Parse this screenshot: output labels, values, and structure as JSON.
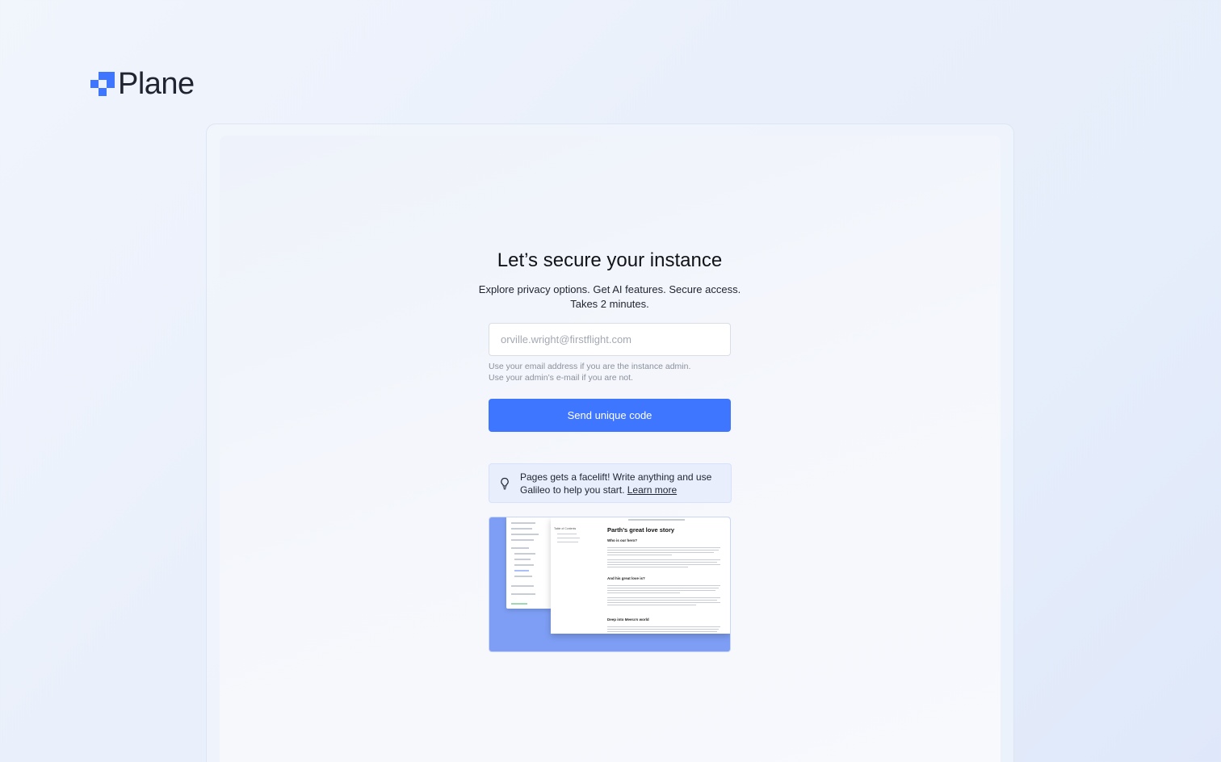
{
  "brand": {
    "name": "Plane",
    "accent": "#3f76ff"
  },
  "auth": {
    "title": "Let’s secure your instance",
    "subtitle_line1": "Explore privacy options. Get AI features. Secure access.",
    "subtitle_line2": "Takes 2 minutes.",
    "email_placeholder": "orville.wright@firstflight.com",
    "email_value": "",
    "hint_line1": "Use your email address if you are the instance admin.",
    "hint_line2": "Use your admin’s e-mail if you are not.",
    "submit_label": "Send unique code"
  },
  "promo": {
    "icon": "lightbulb-icon",
    "text": "Pages gets a facelift! Write anything and use Galileo to help you start.",
    "link_label": "Learn more"
  },
  "preview": {
    "doc_title": "Parth’s great love story",
    "toc_title": "Table of Contents",
    "headings": [
      "Who is our hero?",
      "And his great love is?",
      "Deep into Meera’s world"
    ]
  }
}
